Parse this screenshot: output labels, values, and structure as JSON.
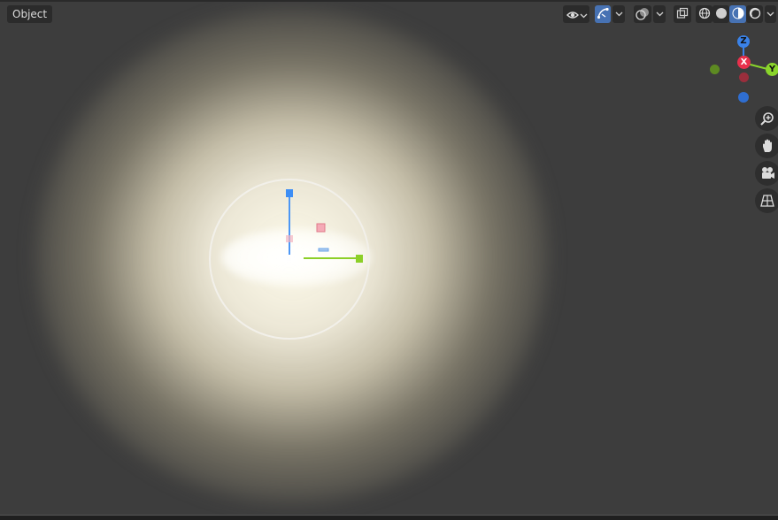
{
  "header": {
    "mode_label": "Object"
  },
  "gizmo": {
    "axes": {
      "z": "Z",
      "x": "X",
      "y": "Y"
    },
    "colors": {
      "x": "#e8304c",
      "y": "#8ad52b",
      "z": "#3a82e8",
      "neg_x": "#9a2e3c",
      "neg_y": "#5d8a22",
      "neg_z": "#2f6ed1"
    }
  },
  "viewport": {
    "background": "#3d3d3d",
    "light_glow": "#fffaeb"
  },
  "icons": [
    "visibility-icon",
    "gizmo-toggle-icon",
    "overlay-icon",
    "xray-icon",
    "wireframe-shading-icon",
    "solid-shading-icon",
    "material-shading-icon",
    "rendered-shading-icon",
    "zoom-icon",
    "hand-pan-icon",
    "camera-icon",
    "perspective-grid-icon"
  ]
}
